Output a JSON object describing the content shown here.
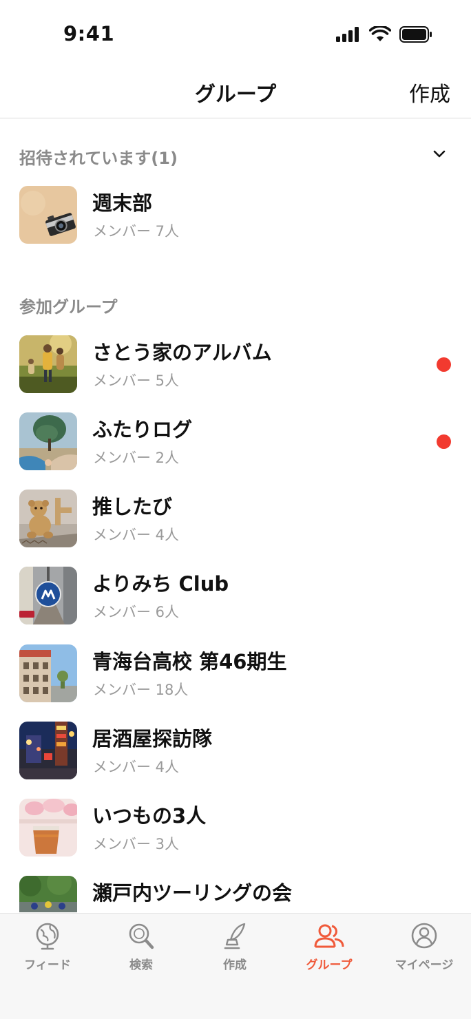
{
  "status_bar": {
    "time": "9:41"
  },
  "nav": {
    "title": "グループ",
    "create_label": "作成"
  },
  "invited": {
    "header": "招待されています(1)",
    "items": [
      {
        "name": "週末部",
        "members": "メンバー 7人"
      }
    ]
  },
  "joined": {
    "header": "参加グループ",
    "items": [
      {
        "name": "さとう家のアルバム",
        "members": "メンバー 5人",
        "unread": true
      },
      {
        "name": "ふたりログ",
        "members": "メンバー 2人",
        "unread": true
      },
      {
        "name": "推したび",
        "members": "メンバー 4人",
        "unread": false
      },
      {
        "name": "よりみち Club",
        "members": "メンバー 6人",
        "unread": false
      },
      {
        "name": "青海台高校 第46期生",
        "members": "メンバー 18人",
        "unread": false
      },
      {
        "name": "居酒屋探訪隊",
        "members": "メンバー 4人",
        "unread": false
      },
      {
        "name": "いつもの3人",
        "members": "メンバー 3人",
        "unread": false
      },
      {
        "name": "瀬戸内ツーリングの会",
        "members": "",
        "unread": false
      }
    ]
  },
  "tab_bar": {
    "items": [
      {
        "label": "フィード",
        "icon": "globe-icon"
      },
      {
        "label": "検索",
        "icon": "search-icon"
      },
      {
        "label": "作成",
        "icon": "quill-icon"
      },
      {
        "label": "グループ",
        "icon": "group-icon"
      },
      {
        "label": "マイページ",
        "icon": "profile-icon"
      }
    ]
  },
  "colors": {
    "accent": "#f05a3a",
    "unread_dot": "#f23a2f",
    "secondary_text": "#9a9a9a"
  }
}
